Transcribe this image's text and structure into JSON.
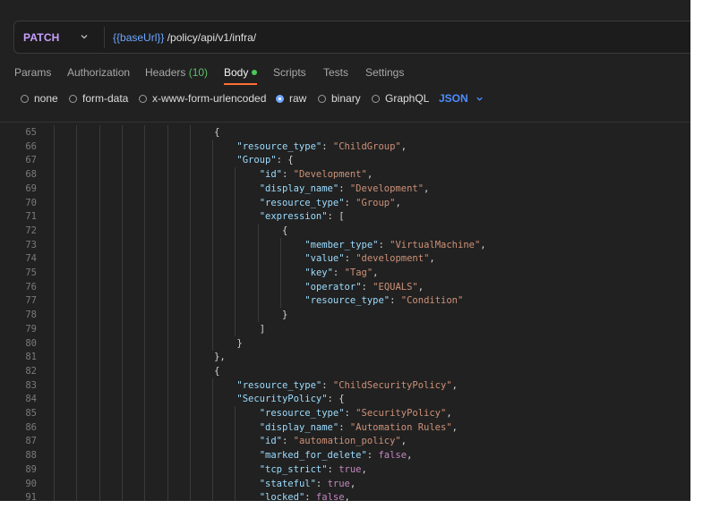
{
  "request": {
    "method": "PATCH",
    "url_variable": "{{baseUrl}}",
    "url_path": " /policy/api/v1/infra/"
  },
  "tabs": [
    {
      "label": "Params"
    },
    {
      "label": "Authorization"
    },
    {
      "label": "Headers",
      "count": "(10)"
    },
    {
      "label": "Body",
      "active": true,
      "indicator": "green-dot"
    },
    {
      "label": "Scripts"
    },
    {
      "label": "Tests"
    },
    {
      "label": "Settings"
    }
  ],
  "body_options": {
    "modes": [
      "none",
      "form-data",
      "x-www-form-urlencoded",
      "raw",
      "binary",
      "GraphQL"
    ],
    "selected": "raw",
    "language": "JSON"
  },
  "colors": {
    "method": "#c9a0ff",
    "variable": "#6ea8ff",
    "active_tab_underline": "#ff6c37",
    "json_key": "#9cdcfe",
    "json_string": "#ce9178",
    "json_literal": "#c586c0"
  },
  "editor": {
    "lines": [
      {
        "n": "65",
        "indent": 7,
        "tokens": [
          [
            "p",
            "{"
          ]
        ]
      },
      {
        "n": "66",
        "indent": 8,
        "tokens": [
          [
            "k",
            "\"resource_type\""
          ],
          [
            "p",
            ": "
          ],
          [
            "s",
            "\"ChildGroup\""
          ],
          [
            "p",
            ","
          ]
        ]
      },
      {
        "n": "67",
        "indent": 8,
        "tokens": [
          [
            "k",
            "\"Group\""
          ],
          [
            "p",
            ": {"
          ]
        ]
      },
      {
        "n": "68",
        "indent": 9,
        "tokens": [
          [
            "k",
            "\"id\""
          ],
          [
            "p",
            ": "
          ],
          [
            "s",
            "\"Development\""
          ],
          [
            "p",
            ","
          ]
        ]
      },
      {
        "n": "69",
        "indent": 9,
        "tokens": [
          [
            "k",
            "\"display_name\""
          ],
          [
            "p",
            ": "
          ],
          [
            "s",
            "\"Development\""
          ],
          [
            "p",
            ","
          ]
        ]
      },
      {
        "n": "70",
        "indent": 9,
        "tokens": [
          [
            "k",
            "\"resource_type\""
          ],
          [
            "p",
            ": "
          ],
          [
            "s",
            "\"Group\""
          ],
          [
            "p",
            ","
          ]
        ]
      },
      {
        "n": "71",
        "indent": 9,
        "tokens": [
          [
            "k",
            "\"expression\""
          ],
          [
            "p",
            ": ["
          ]
        ]
      },
      {
        "n": "72",
        "indent": 10,
        "tokens": [
          [
            "p",
            "{"
          ]
        ]
      },
      {
        "n": "73",
        "indent": 11,
        "tokens": [
          [
            "k",
            "\"member_type\""
          ],
          [
            "p",
            ": "
          ],
          [
            "s",
            "\"VirtualMachine\""
          ],
          [
            "p",
            ","
          ]
        ]
      },
      {
        "n": "74",
        "indent": 11,
        "tokens": [
          [
            "k",
            "\"value\""
          ],
          [
            "p",
            ": "
          ],
          [
            "s",
            "\"development\""
          ],
          [
            "p",
            ","
          ]
        ]
      },
      {
        "n": "75",
        "indent": 11,
        "tokens": [
          [
            "k",
            "\"key\""
          ],
          [
            "p",
            ": "
          ],
          [
            "s",
            "\"Tag\""
          ],
          [
            "p",
            ","
          ]
        ]
      },
      {
        "n": "76",
        "indent": 11,
        "tokens": [
          [
            "k",
            "\"operator\""
          ],
          [
            "p",
            ": "
          ],
          [
            "s",
            "\"EQUALS\""
          ],
          [
            "p",
            ","
          ]
        ]
      },
      {
        "n": "77",
        "indent": 11,
        "tokens": [
          [
            "k",
            "\"resource_type\""
          ],
          [
            "p",
            ": "
          ],
          [
            "s",
            "\"Condition\""
          ]
        ]
      },
      {
        "n": "78",
        "indent": 10,
        "tokens": [
          [
            "p",
            "}"
          ]
        ]
      },
      {
        "n": "79",
        "indent": 9,
        "tokens": [
          [
            "p",
            "]"
          ]
        ]
      },
      {
        "n": "80",
        "indent": 8,
        "tokens": [
          [
            "p",
            "}"
          ]
        ]
      },
      {
        "n": "81",
        "indent": 7,
        "tokens": [
          [
            "p",
            "},"
          ]
        ]
      },
      {
        "n": "82",
        "indent": 7,
        "tokens": [
          [
            "p",
            "{"
          ]
        ]
      },
      {
        "n": "83",
        "indent": 8,
        "tokens": [
          [
            "k",
            "\"resource_type\""
          ],
          [
            "p",
            ": "
          ],
          [
            "s",
            "\"ChildSecurityPolicy\""
          ],
          [
            "p",
            ","
          ]
        ]
      },
      {
        "n": "84",
        "indent": 8,
        "tokens": [
          [
            "k",
            "\"SecurityPolicy\""
          ],
          [
            "p",
            ": {"
          ]
        ]
      },
      {
        "n": "85",
        "indent": 9,
        "tokens": [
          [
            "k",
            "\"resource_type\""
          ],
          [
            "p",
            ": "
          ],
          [
            "s",
            "\"SecurityPolicy\""
          ],
          [
            "p",
            ","
          ]
        ]
      },
      {
        "n": "86",
        "indent": 9,
        "tokens": [
          [
            "k",
            "\"display_name\""
          ],
          [
            "p",
            ": "
          ],
          [
            "s",
            "\"Automation Rules\""
          ],
          [
            "p",
            ","
          ]
        ]
      },
      {
        "n": "87",
        "indent": 9,
        "tokens": [
          [
            "k",
            "\"id\""
          ],
          [
            "p",
            ": "
          ],
          [
            "s",
            "\"automation_policy\""
          ],
          [
            "p",
            ","
          ]
        ]
      },
      {
        "n": "88",
        "indent": 9,
        "tokens": [
          [
            "k",
            "\"marked_for_delete\""
          ],
          [
            "p",
            ": "
          ],
          [
            "b",
            "false"
          ],
          [
            "p",
            ","
          ]
        ]
      },
      {
        "n": "89",
        "indent": 9,
        "tokens": [
          [
            "k",
            "\"tcp_strict\""
          ],
          [
            "p",
            ": "
          ],
          [
            "b",
            "true"
          ],
          [
            "p",
            ","
          ]
        ]
      },
      {
        "n": "90",
        "indent": 9,
        "tokens": [
          [
            "k",
            "\"stateful\""
          ],
          [
            "p",
            ": "
          ],
          [
            "b",
            "true"
          ],
          [
            "p",
            ","
          ]
        ]
      },
      {
        "n": "91",
        "indent": 9,
        "tokens": [
          [
            "k",
            "\"locked\""
          ],
          [
            "p",
            ": "
          ],
          [
            "b",
            "false"
          ],
          [
            "p",
            ","
          ]
        ]
      }
    ]
  }
}
